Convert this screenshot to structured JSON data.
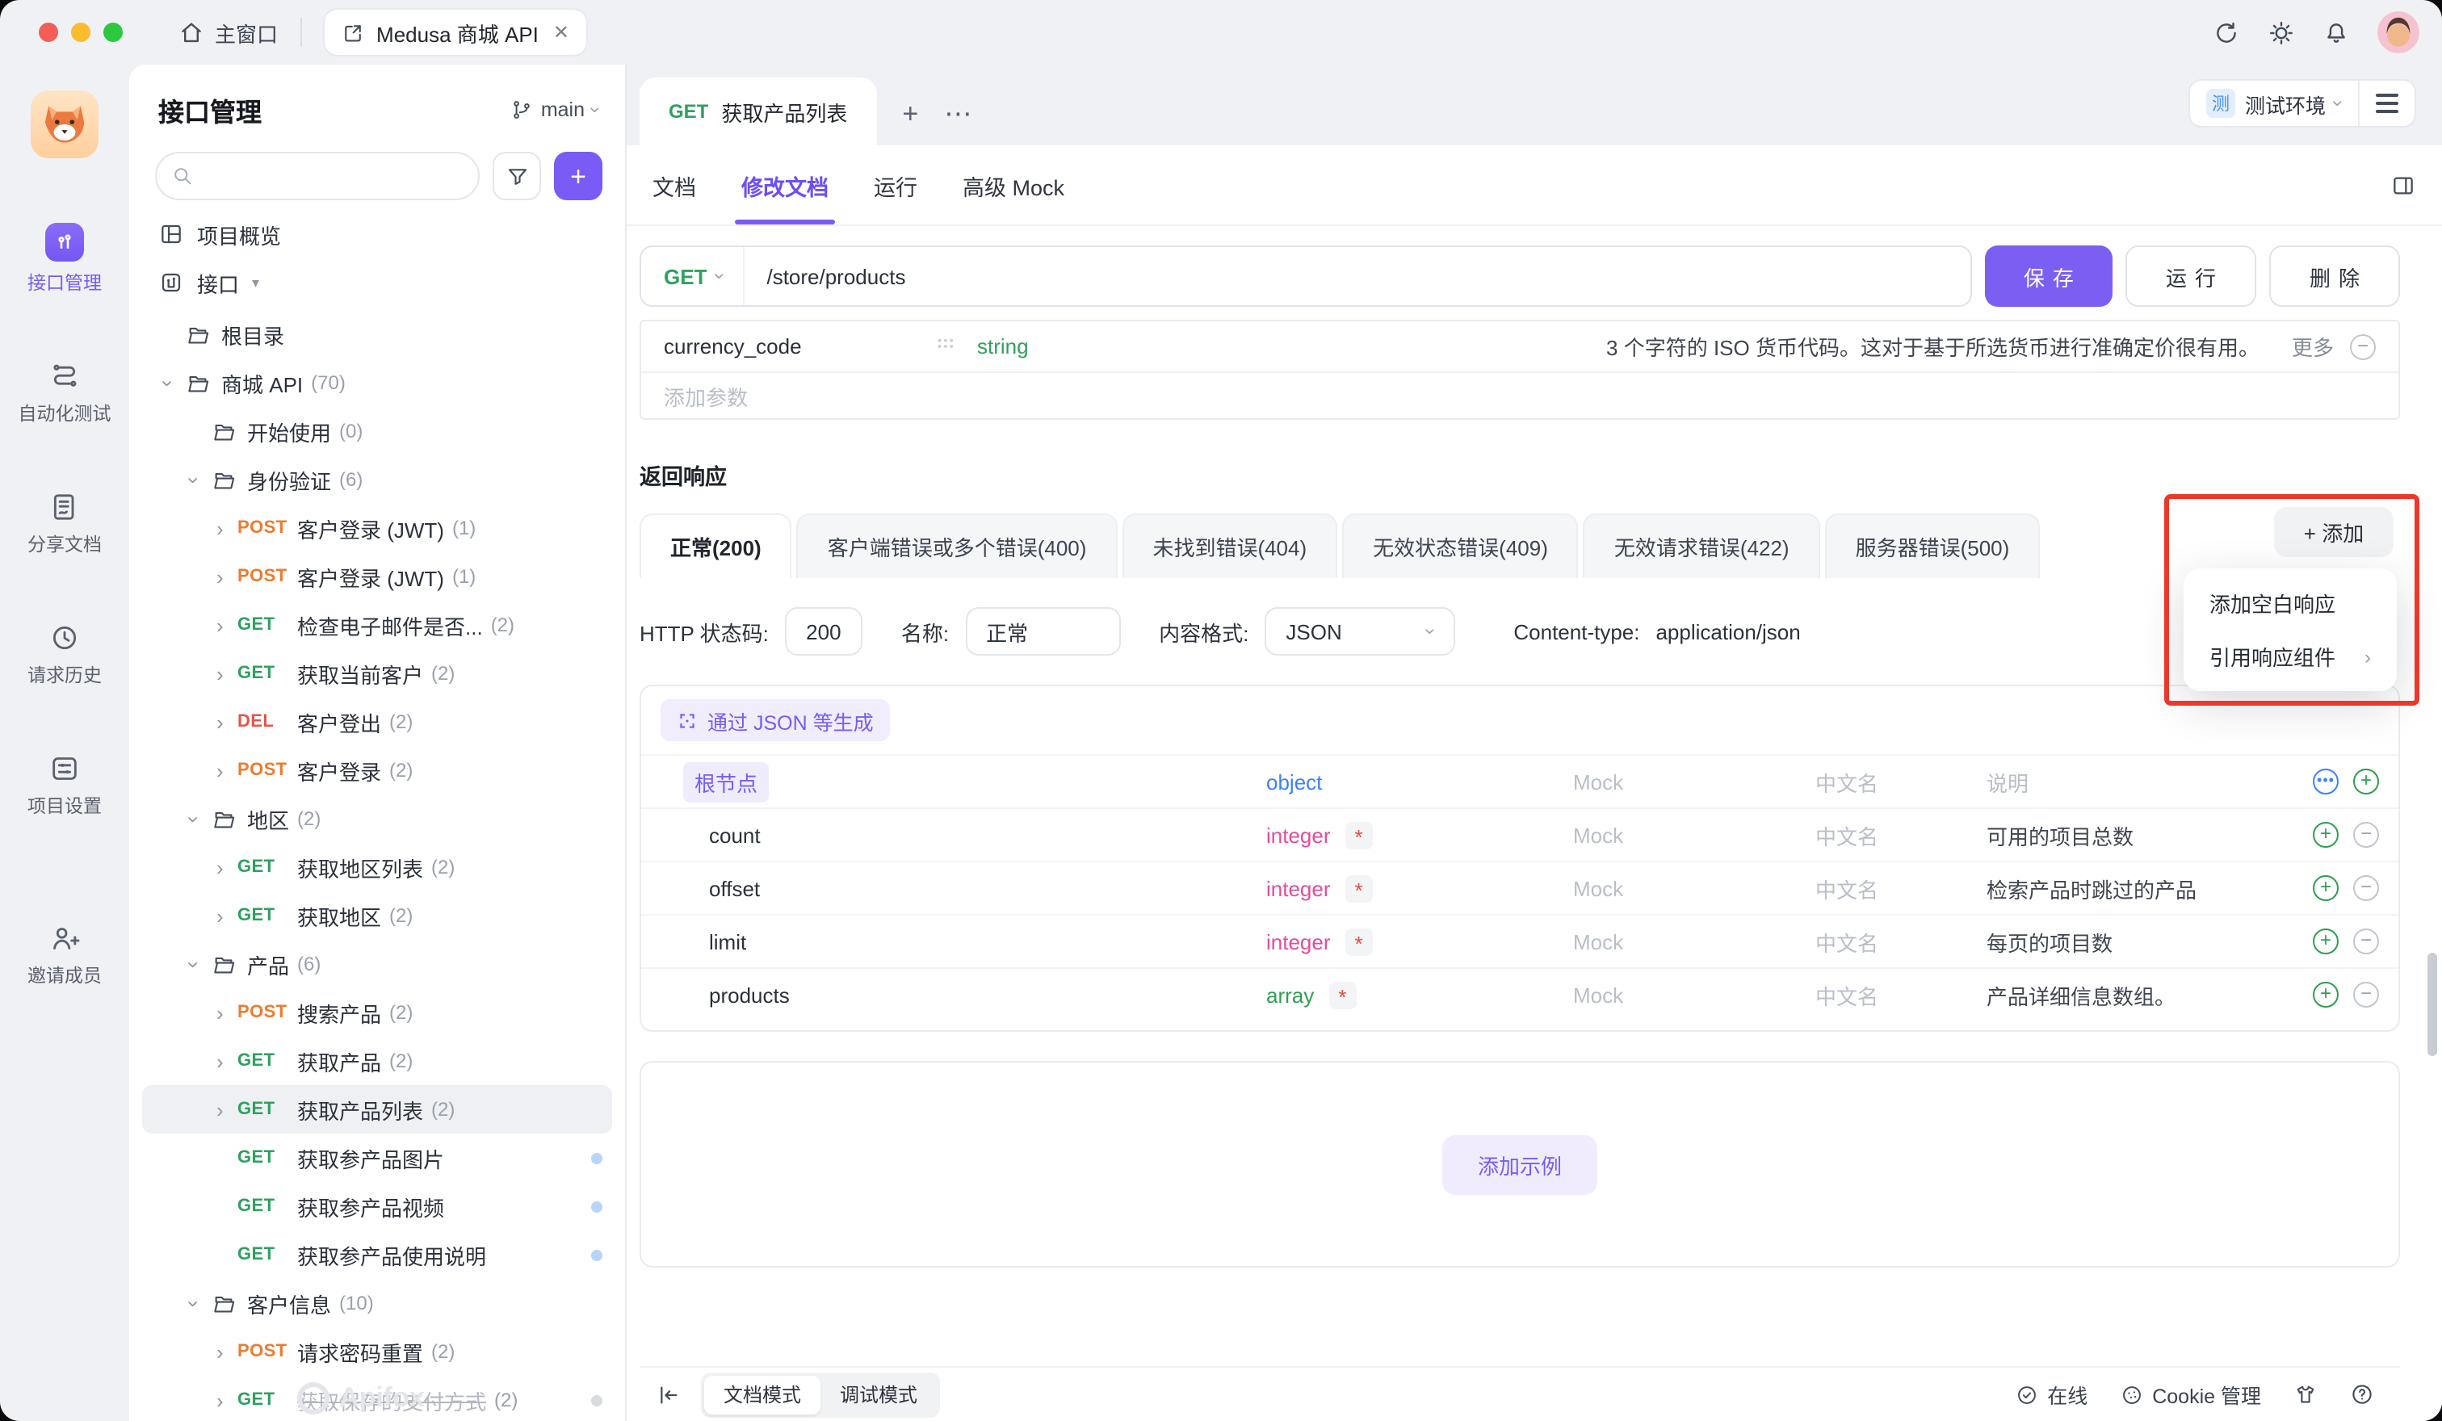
{
  "colors": {
    "accent": "#7a5bf5",
    "get": "#2ea15f",
    "post": "#ed7b2f",
    "del": "#e0564a",
    "type_object": "#3b82f6",
    "type_integer": "#e24c9d",
    "type_array": "#2f9e4f",
    "annotation": "#ed372a"
  },
  "topbar": {
    "home": "主窗口",
    "tab": "Medusa 商城 API",
    "close": "✕"
  },
  "rail": {
    "items": [
      {
        "label": "接口管理",
        "active": true
      },
      {
        "label": "自动化测试"
      },
      {
        "label": "分享文档"
      },
      {
        "label": "请求历史"
      },
      {
        "label": "项目设置"
      },
      {
        "label": "邀请成员"
      }
    ]
  },
  "sidebar": {
    "title": "接口管理",
    "branch": "main",
    "overview": "项目概览",
    "api_section": "接口",
    "tree": [
      {
        "lv": 2,
        "icon": "folder",
        "label": "根目录"
      },
      {
        "lv": 2,
        "caret": "down",
        "icon": "folder",
        "label": "商城 API",
        "count": "(70)"
      },
      {
        "lv": 3,
        "icon": "folder",
        "label": "开始使用",
        "count": "(0)"
      },
      {
        "lv": 3,
        "caret": "down",
        "icon": "folder",
        "label": "身份验证",
        "count": "(6)"
      },
      {
        "lv": 4,
        "caret": "right",
        "method": "POST",
        "label": "客户登录 (JWT)",
        "count": "(1)"
      },
      {
        "lv": 4,
        "caret": "right",
        "method": "POST",
        "label": "客户登录 (JWT)",
        "count": "(1)"
      },
      {
        "lv": 4,
        "caret": "right",
        "method": "GET",
        "label": "检查电子邮件是否...",
        "count": "(2)"
      },
      {
        "lv": 4,
        "caret": "right",
        "method": "GET",
        "label": "获取当前客户",
        "count": "(2)"
      },
      {
        "lv": 4,
        "caret": "right",
        "method": "DEL",
        "label": "客户登出",
        "count": "(2)"
      },
      {
        "lv": 4,
        "caret": "right",
        "method": "POST",
        "label": "客户登录",
        "count": "(2)"
      },
      {
        "lv": 3,
        "caret": "down",
        "icon": "folder",
        "label": "地区",
        "count": "(2)"
      },
      {
        "lv": 4,
        "caret": "right",
        "method": "GET",
        "label": "获取地区列表",
        "count": "(2)"
      },
      {
        "lv": 4,
        "caret": "right",
        "method": "GET",
        "label": "获取地区",
        "count": "(2)"
      },
      {
        "lv": 3,
        "caret": "down",
        "icon": "folder",
        "label": "产品",
        "count": "(6)"
      },
      {
        "lv": 4,
        "caret": "right",
        "method": "POST",
        "label": "搜索产品",
        "count": "(2)"
      },
      {
        "lv": 4,
        "caret": "right",
        "method": "GET",
        "label": "获取产品",
        "count": "(2)"
      },
      {
        "lv": 4,
        "caret": "right",
        "method": "GET",
        "label": "获取产品列表",
        "count": "(2)",
        "selected": true
      },
      {
        "lv": 4,
        "method": "GET",
        "label": "获取参产品图片",
        "dot": "blue"
      },
      {
        "lv": 4,
        "method": "GET",
        "label": "获取参产品视频",
        "dot": "blue"
      },
      {
        "lv": 4,
        "method": "GET",
        "label": "获取参产品使用说明",
        "dot": "blue"
      },
      {
        "lv": 3,
        "caret": "down",
        "icon": "folder",
        "label": "客户信息",
        "count": "(10)"
      },
      {
        "lv": 4,
        "caret": "right",
        "method": "POST",
        "label": "请求密码重置",
        "count": "(2)"
      },
      {
        "lv": 4,
        "caret": "right",
        "method": "GET",
        "label": "获取保存的支付方式",
        "count": "(2)",
        "strike": true,
        "dot": "grey"
      }
    ],
    "watermark": "Apifox"
  },
  "header": {
    "doc_tab_method": "GET",
    "doc_tab_title": "获取产品列表",
    "env_badge": "测",
    "env_label": "测试环境",
    "tabs": [
      {
        "label": "文档"
      },
      {
        "label": "修改文档",
        "state": "active"
      },
      {
        "label": "运行"
      },
      {
        "label": "高级 Mock"
      }
    ]
  },
  "request": {
    "method": "GET",
    "url": "/store/products",
    "save": "保存",
    "run": "运行",
    "delete": "删除",
    "param": {
      "name": "currency_code",
      "type": "string",
      "desc": "3 个字符的 ISO 货币代码。这对于基于所选货币进行准确定价很有用。",
      "more": "更多"
    },
    "add_param_placeholder": "添加参数"
  },
  "response": {
    "section_title": "返回响应",
    "tabs": [
      {
        "label": "正常(200)",
        "state": "active"
      },
      {
        "label": "客户端错误或多个错误(400)"
      },
      {
        "label": "未找到错误(404)"
      },
      {
        "label": "无效状态错误(409)"
      },
      {
        "label": "无效请求错误(422)"
      },
      {
        "label": "服务器错误(500)"
      }
    ],
    "add_button": "+ 添加",
    "menu": {
      "item_blank": "添加空白响应",
      "item_ref": "引用响应组件"
    },
    "status_label": "HTTP 状态码:",
    "status_value": "200",
    "name_label": "名称:",
    "name_value": "正常",
    "format_label": "内容格式:",
    "format_value": "JSON",
    "content_type_label": "Content-type:",
    "content_type_value": "application/json",
    "generate_button": "通过 JSON 等生成",
    "schema": {
      "rows": [
        {
          "caret": "down",
          "name": "根节点",
          "root": true,
          "type": "object",
          "mock": "Mock",
          "cn": "中文名",
          "desc": "说明",
          "desc_placeholder": true
        },
        {
          "child": true,
          "name": "count",
          "type": "integer",
          "required": true,
          "minus": true,
          "mock": "Mock",
          "cn": "中文名",
          "desc": "可用的项目总数"
        },
        {
          "child": true,
          "name": "offset",
          "type": "integer",
          "required": true,
          "minus": true,
          "mock": "Mock",
          "cn": "中文名",
          "desc": "检索产品时跳过的产品"
        },
        {
          "child": true,
          "name": "limit",
          "type": "integer",
          "required": true,
          "minus": true,
          "mock": "Mock",
          "cn": "中文名",
          "desc": "每页的项目数"
        },
        {
          "child": true,
          "caret": "right",
          "name": "products",
          "type": "array",
          "required": true,
          "minus": true,
          "mock": "Mock",
          "cn": "中文名",
          "desc": "产品详细信息数组。"
        }
      ]
    },
    "add_example": "添加示例"
  },
  "footer": {
    "doc_mode": "文档模式",
    "debug_mode": "调试模式",
    "online": "在线",
    "cookie": "Cookie 管理"
  }
}
